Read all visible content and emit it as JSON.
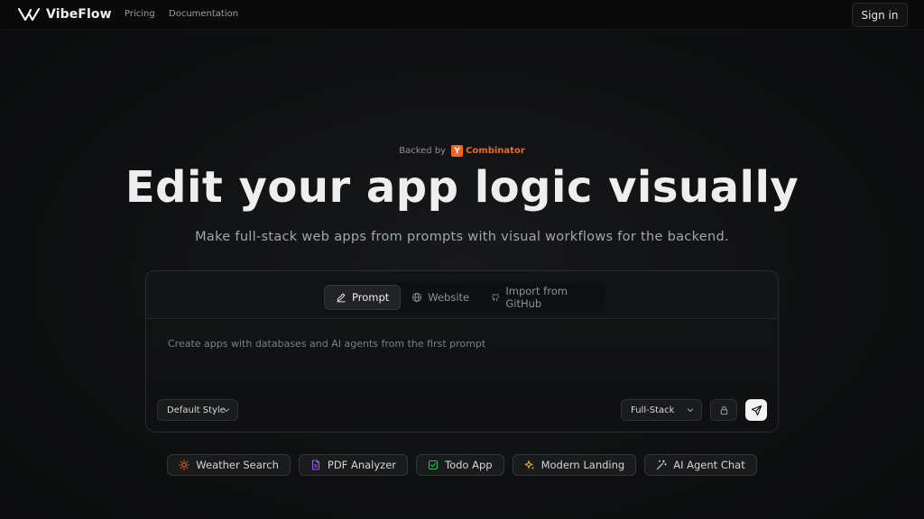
{
  "header": {
    "brand": "VibeFlow",
    "nav": [
      "Pricing",
      "Documentation"
    ],
    "sign_in": "Sign in"
  },
  "hero": {
    "backed_by": "Backed by",
    "yc_mark": "Y",
    "yc_name": "Combinator",
    "title": "Edit your app logic visually",
    "subtitle": "Make full-stack web apps from prompts with visual workflows for the backend."
  },
  "composer": {
    "tabs": [
      {
        "label": "Prompt",
        "icon": "pencil-icon",
        "active": true
      },
      {
        "label": "Website",
        "icon": "globe-icon",
        "active": false
      },
      {
        "label": "Import from GitHub",
        "icon": "github-icon",
        "active": false
      }
    ],
    "input_value": "",
    "input_placeholder": "Create apps with databases and AI agents from the first prompt",
    "style_select": "Default Style",
    "stack_select": "Full-Stack"
  },
  "suggestions": [
    {
      "label": "Weather Search",
      "icon": "sun-icon",
      "color": "#f26625"
    },
    {
      "label": "PDF Analyzer",
      "icon": "document-icon",
      "color": "#a855f7"
    },
    {
      "label": "Todo App",
      "icon": "checkbox-icon",
      "color": "#22c55e"
    },
    {
      "label": "Modern Landing",
      "icon": "sparkles-icon",
      "color": "#eab308"
    },
    {
      "label": "AI Agent Chat",
      "icon": "magic-wand-icon",
      "color": "#d4d4d4"
    }
  ],
  "colors": {
    "background": "#0b0c0d",
    "accent_yc": "#f26625",
    "send_button": "#f2f2f2"
  }
}
